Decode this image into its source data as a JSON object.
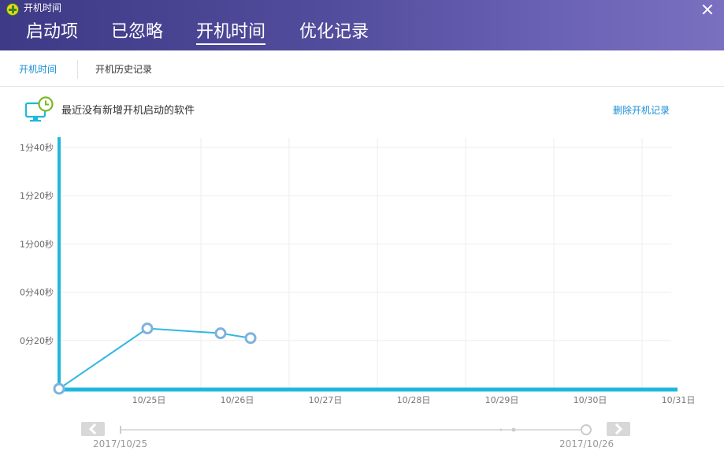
{
  "window": {
    "title": "开机时间"
  },
  "header": {
    "tabs": [
      {
        "label": "启动项",
        "active": false
      },
      {
        "label": "已忽略",
        "active": false
      },
      {
        "label": "开机时间",
        "active": true
      },
      {
        "label": "优化记录",
        "active": false
      }
    ]
  },
  "subtabs": [
    {
      "label": "开机时间",
      "active": true
    },
    {
      "label": "开机历史记录",
      "active": false
    }
  ],
  "info": {
    "message": "最近没有新增开机启动的软件",
    "delete_link": "删除开机记录"
  },
  "colors": {
    "accent": "#1fb8dc",
    "line": "#33b7e0",
    "marker": "#7fb3dc",
    "link": "#1a8fd6",
    "header_start": "#3e3a86",
    "header_end": "#7a70c0"
  },
  "chart_data": {
    "type": "line",
    "x": [
      "10/25日",
      "10/26日",
      "10/27日",
      "10/28日",
      "10/29日",
      "10/30日",
      "10/31日"
    ],
    "y_ticks": [
      "0分20秒",
      "0分40秒",
      "1分00秒",
      "1分20秒",
      "1分40秒"
    ],
    "ylim_seconds": [
      0,
      100
    ],
    "grid": true,
    "series": [
      {
        "points": [
          {
            "day": 24.0,
            "seconds": 0
          },
          {
            "day": 25.0,
            "seconds": 25
          },
          {
            "day": 25.83,
            "seconds": 23
          },
          {
            "day": 26.17,
            "seconds": 21
          }
        ]
      }
    ]
  },
  "range": {
    "start_label": "2017/10/25",
    "end_label": "2017/10/26"
  }
}
